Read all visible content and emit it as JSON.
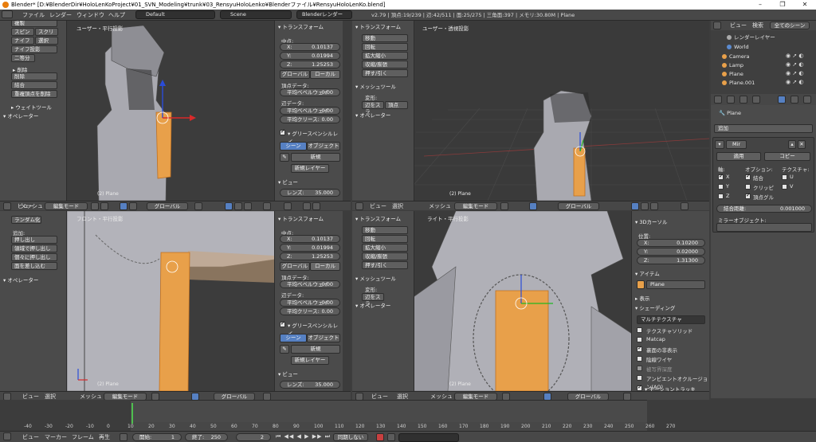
{
  "titlebar": {
    "title": "Blender* [D:¥BlenderDir¥HoloLenKoProject¥01_SVN_Modeling¥trunk¥03_RensyuHoloLenko¥Blenderファイル¥RensyuHoloLenKo.blend]",
    "minimize": "–",
    "maximize": "❐",
    "close": "✕"
  },
  "menu": {
    "file": "ファイル",
    "render": "レンダー",
    "window": "ウィンドウ",
    "help": "ヘルプ",
    "layout": "Default",
    "scene": "Scene",
    "engine": "Blenderレンダー",
    "stats": "v2.79 | 頂点:19/239 | 辺:42/511 | 面:25/275 | 三角面:397 | メモリ:30.80M | Plane"
  },
  "viewports": {
    "top_left_label": "ユーザー・平行投影",
    "top_right_label": "ユーザー・透視投影",
    "bottom_left_label": "フロント・平行投影",
    "bottom_right_label": "ライト・平行投影",
    "object_label": "(2) Plane"
  },
  "shelf_tl": {
    "items": [
      "スピン",
      "スクリュー",
      "ナイフ",
      "選択",
      "ナイフ投影",
      "二等分"
    ],
    "remove_title": "削除",
    "delete": "削除",
    "merge": "結合",
    "remove_doubles": "重複頂点を削除",
    "weight_tools": "ウェイトツール",
    "operator": "オペレーター",
    "top_cut": "複製"
  },
  "shelf_tr": {
    "transform": "トランスフォーム",
    "items": [
      "移動",
      "回転",
      "拡大縮小",
      "収縮/膨張",
      "押す/引く"
    ],
    "mesh_tools": "メッシュツール",
    "deform": "変形:",
    "slide": "辺をスラ",
    "vertex": "頂点",
    "operator": "オペレーター"
  },
  "shelf_bl": {
    "random": "ランダム化",
    "add": "追加:",
    "extrude": "押し出し",
    "extrude_region": "領域で押し出し",
    "extrude_individual": "個々に押し出し",
    "inset": "面を差し込む",
    "operator": "オペレーター"
  },
  "shelf_br": {
    "transform": "トランスフォーム",
    "items": [
      "移動",
      "回転",
      "拡大縮小",
      "収縮/膨張",
      "押す/引く"
    ],
    "mesh_tools": "メッシュツール",
    "deform": "変形:",
    "slide": "辺をスラ",
    "operator": "オペレーター"
  },
  "nprops": {
    "transform": "トランスフォーム",
    "median": "中点:",
    "x_label": "X:",
    "y_label": "Y:",
    "z_label": "Z:",
    "x_val": "0.10137",
    "y_val": "0.01994",
    "z_val": "1.25253",
    "global": "グローバル",
    "local": "ローカル",
    "vertex_data": "頂点データ:",
    "mean_bevel_weight": "平均ベベルウェイ",
    "mean_bevel_val": "0.00",
    "edge_data": "辺データ:",
    "mean_crease": "平均クリース:",
    "mean_crease_val": "0.00",
    "grease_pencil": "グリースペンシルレイ",
    "scene": "シーン",
    "object": "オブジェクト",
    "new": "新規",
    "new_layer": "新規レイヤー",
    "view": "ビュー",
    "lens": "レンズ:",
    "lens_val": "35.000"
  },
  "cursor_props": {
    "title": "3Dカーソル",
    "location": "位置:",
    "x_val": "0.10200",
    "y_val": "0.02000",
    "z_val": "1.31300",
    "item": "アイテム",
    "item_name": "Plane",
    "display": "表示",
    "shading": "シェーディング",
    "multitexture": "マルチテクスチャ",
    "tex_solid": "テクスチャソリッド",
    "matcap": "Matcap",
    "backface": "裏面の非表示",
    "hidden_wire": "陰線ワイヤ",
    "depth_of_field": "被写界深度",
    "ambient_occlusion": "アンビエントオクルージョン(AO)",
    "motion_tracking": "モーショントラッキ"
  },
  "outliner": {
    "view": "ビュー",
    "search": "検索",
    "all_scenes": "全てのシーン",
    "rows": [
      "レンダーレイヤー",
      "World",
      "Camera",
      "Lamp",
      "Plane",
      "Plane.001"
    ]
  },
  "modifier": {
    "breadcrumb": "Plane",
    "add": "追加",
    "name": "Mir",
    "apply": "適用",
    "copy": "コピー",
    "axis": "軸:",
    "options": "オプション:",
    "texture": "テクスチャ:",
    "x": "X",
    "y": "Y",
    "z": "Z",
    "merge": "結合",
    "clipping": "クリッピ",
    "vertex_groups": "頂点グル",
    "u": "U",
    "v": "V",
    "merge_limit": "結合距離:",
    "merge_limit_val": "0.001000",
    "mirror_object": "ミラーオブジェクト:"
  },
  "vp_header": {
    "view": "ビュー",
    "select": "選択",
    "mesh": "メッシュ",
    "edit_mode": "編集モード",
    "global": "グローバル"
  },
  "timeline": {
    "ticks": [
      "-40",
      "-30",
      "-20",
      "-10",
      "0",
      "10",
      "20",
      "30",
      "40",
      "50",
      "60",
      "70",
      "80",
      "90",
      "100",
      "110",
      "120",
      "130",
      "140",
      "150",
      "160",
      "170",
      "180",
      "190",
      "200",
      "210",
      "220",
      "230",
      "240",
      "250",
      "260",
      "270"
    ]
  },
  "footer": {
    "view": "ビュー",
    "marker": "マーカー",
    "frame": "フレーム",
    "playback": "再生",
    "start_label": "開始:",
    "start_val": "1",
    "end_label": "終了:",
    "end_val": "250",
    "current": "2",
    "sync": "同期しない"
  },
  "colors": {
    "selection": "#e8a04a",
    "accent": "#5680c2"
  }
}
